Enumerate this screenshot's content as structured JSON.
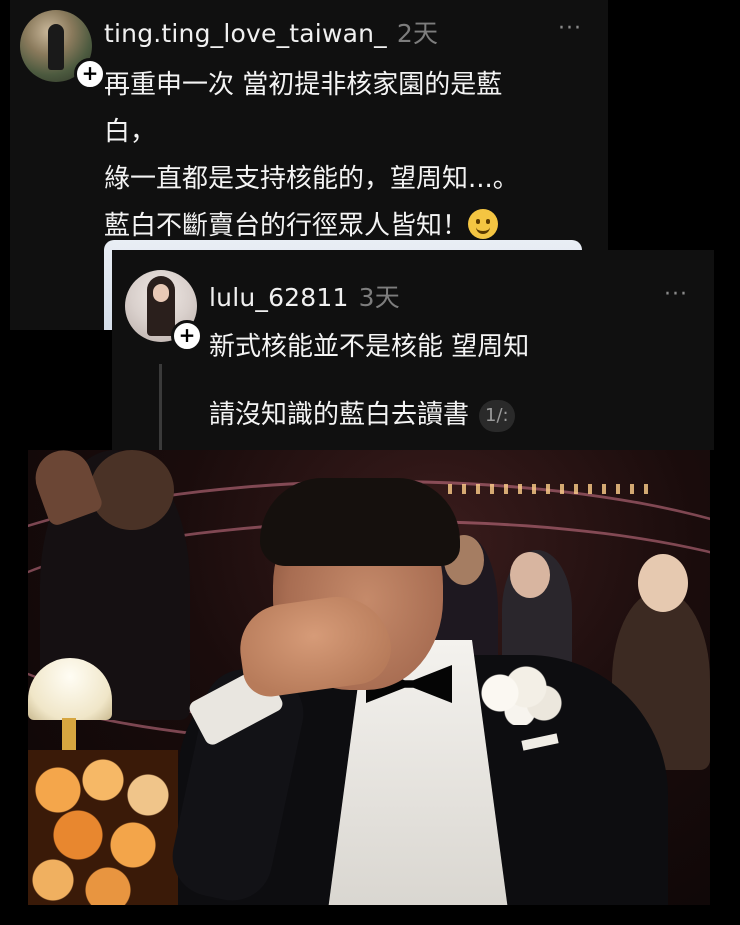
{
  "post1": {
    "username": "ting.ting_love_taiwan_",
    "time": "2天",
    "more": "···",
    "lines": [
      "再重申一次 當初提非核家園的是藍",
      "白，",
      "綠一直都是支持核能的，望周知...。",
      "藍白不斷賣台的行徑眾人皆知！"
    ],
    "emoji": "smiling-face-emoji"
  },
  "post2": {
    "username": "lulu_62811",
    "time": "3天",
    "more": "···",
    "line1": "新式核能並不是核能 望周知",
    "line2": "請沒知識的藍白去讀書",
    "pager": "1/:"
  },
  "photo": {
    "description_icon": "man-covering-face-photo"
  },
  "colors": {
    "background": "#000000",
    "card": "#101010",
    "muted": "#7d7d7d",
    "text": "#f4f4f4"
  }
}
